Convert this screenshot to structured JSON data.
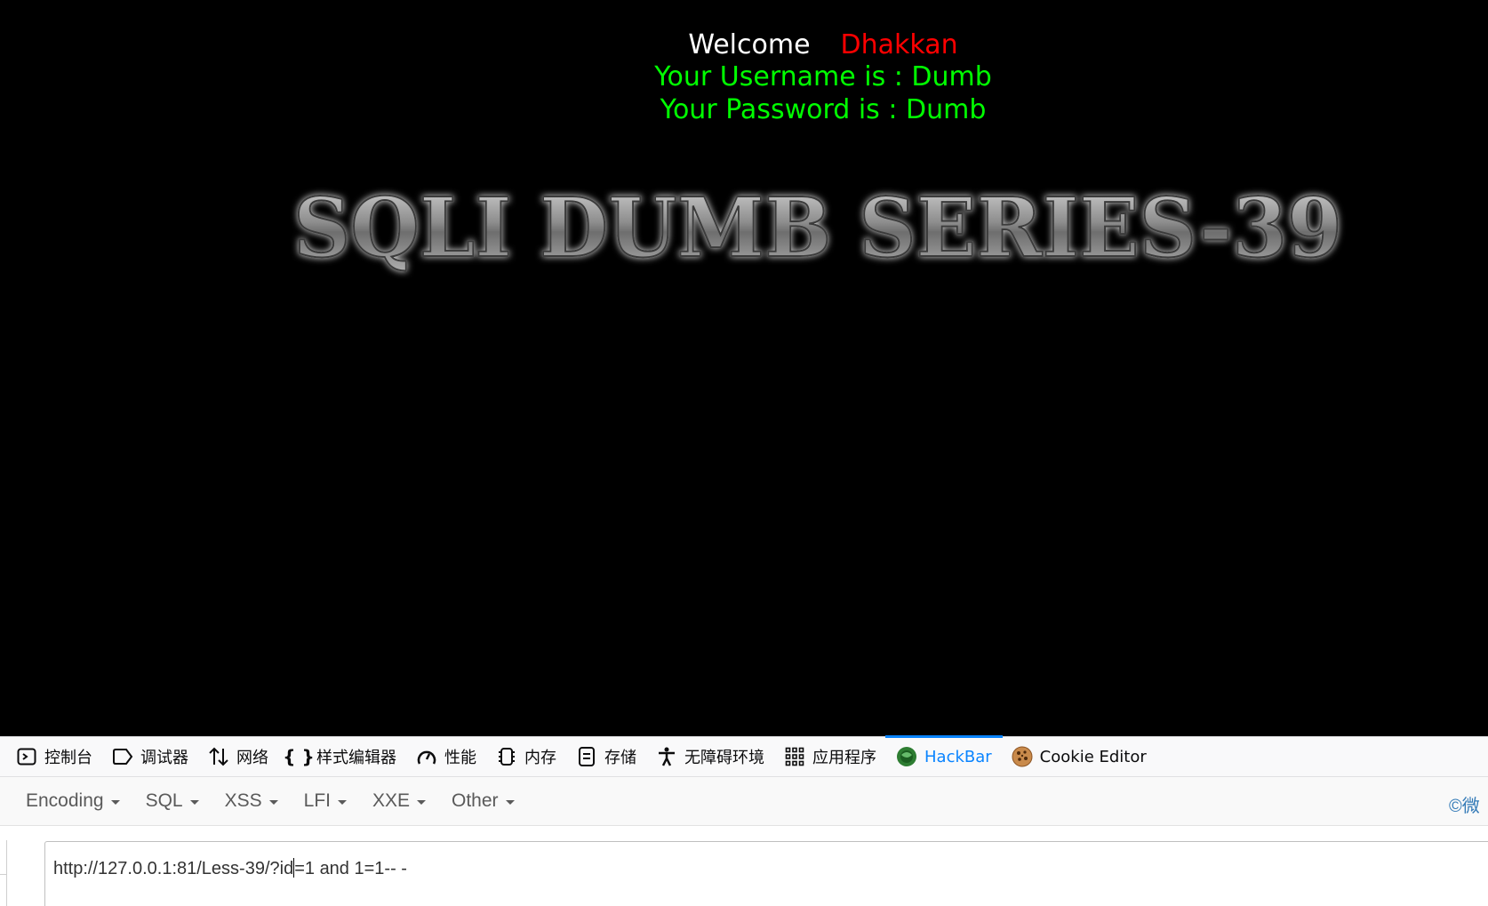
{
  "page": {
    "welcome_word": "Welcome",
    "welcome_name": "Dhakkan",
    "username_line": "Your Username is : Dumb",
    "password_line": "Your Password is : Dumb",
    "banner": "SQLI DUMB SERIES-39",
    "colors": {
      "background": "#000000",
      "welcome": "#ffffff",
      "name": "#ff0000",
      "credentials": "#00ff00"
    }
  },
  "devtools": {
    "tabs": [
      {
        "label": "控制台",
        "icon": "console-icon"
      },
      {
        "label": "调试器",
        "icon": "debugger-icon"
      },
      {
        "label": "网络",
        "icon": "network-icon"
      },
      {
        "label": "样式编辑器",
        "icon": "style-editor-icon"
      },
      {
        "label": "性能",
        "icon": "performance-icon"
      },
      {
        "label": "内存",
        "icon": "memory-icon"
      },
      {
        "label": "存储",
        "icon": "storage-icon"
      },
      {
        "label": "无障碍环境",
        "icon": "accessibility-icon"
      },
      {
        "label": "应用程序",
        "icon": "application-icon"
      },
      {
        "label": "HackBar",
        "icon": "hackbar-icon",
        "active": true
      },
      {
        "label": "Cookie Editor",
        "icon": "cookie-icon"
      }
    ],
    "accent": "#0a84ff"
  },
  "hackbar": {
    "menus": [
      "Encoding",
      "SQL",
      "XSS",
      "LFI",
      "XXE",
      "Other"
    ],
    "copyright": "©微",
    "url_before_caret": "http://127.0.0.1:81/Less-39/?id",
    "url_after_caret": "=1 and 1=1-- -"
  }
}
